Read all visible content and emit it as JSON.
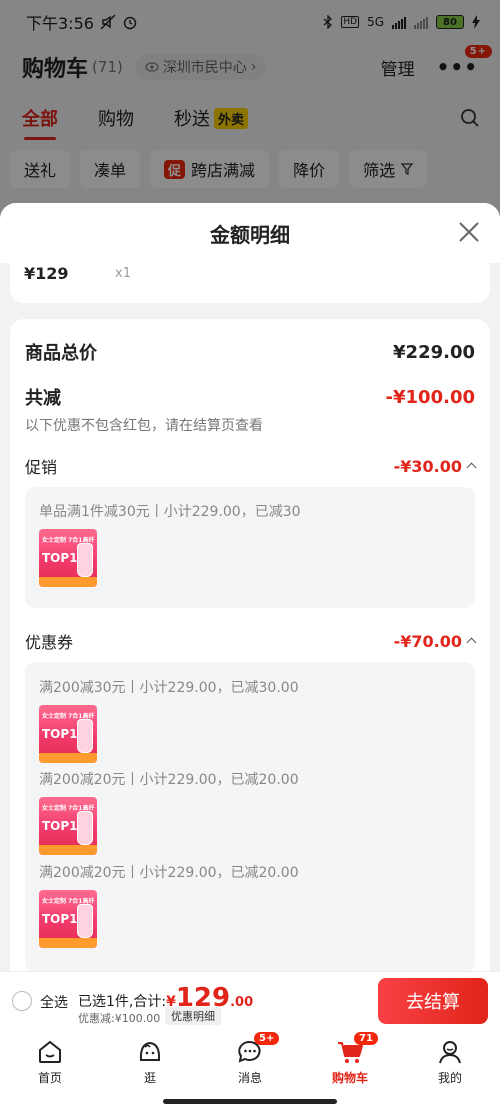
{
  "status_bar": {
    "time": "下午3:56",
    "network": "5G",
    "battery": "80"
  },
  "cart_header": {
    "title": "购物车",
    "count": "(71)",
    "location": "深圳市民中心",
    "manage": "管理",
    "more_badge": "5+"
  },
  "tabs": [
    {
      "label": "全部",
      "active": true
    },
    {
      "label": "购物",
      "active": false
    },
    {
      "label": "秒送",
      "active": false,
      "tag": "外卖"
    }
  ],
  "filters": [
    {
      "label": "送礼"
    },
    {
      "label": "凑单"
    },
    {
      "label": "跨店满减",
      "badge": "促"
    },
    {
      "label": "降价"
    },
    {
      "label": "筛选"
    }
  ],
  "sheet": {
    "title": "金额明细",
    "top_item": {
      "price": "¥129",
      "qty": "x1"
    },
    "total_label": "商品总价",
    "total_value": "¥229.00",
    "reduce_label": "共减",
    "reduce_value": "-¥100.00",
    "note": "以下优惠不包含红包，请在结算页查看",
    "promo": {
      "label": "促销",
      "value": "-¥30.00",
      "items": [
        "单品满1件减30元丨小计229.00，已减30"
      ]
    },
    "coupon": {
      "label": "优惠券",
      "value": "-¥70.00",
      "items": [
        "满200减30元丨小计229.00，已减30.00",
        "满200减20元丨小计229.00，已减20.00",
        "满200减20元丨小计229.00，已减20.00"
      ]
    },
    "thumb": {
      "line1": "女士定制 7合1高纤",
      "line2": "TOP1"
    }
  },
  "checkout": {
    "select_all": "全选",
    "summary": "已选1件,合计:",
    "currency": "¥",
    "total_int": "129",
    "total_dec": ".00",
    "discount": "优惠减:¥100.00",
    "detail_btn": "优惠明细",
    "pay_btn": "去结算"
  },
  "nav": [
    {
      "label": "首页",
      "icon": "home-icon"
    },
    {
      "label": "逛",
      "icon": "explore-icon"
    },
    {
      "label": "消息",
      "icon": "message-icon",
      "badge": "5+"
    },
    {
      "label": "购物车",
      "icon": "cart-icon",
      "badge": "71",
      "active": true
    },
    {
      "label": "我的",
      "icon": "profile-icon"
    }
  ],
  "colors": {
    "accent": "#e1251b",
    "promo_tag": "#ffd400"
  }
}
